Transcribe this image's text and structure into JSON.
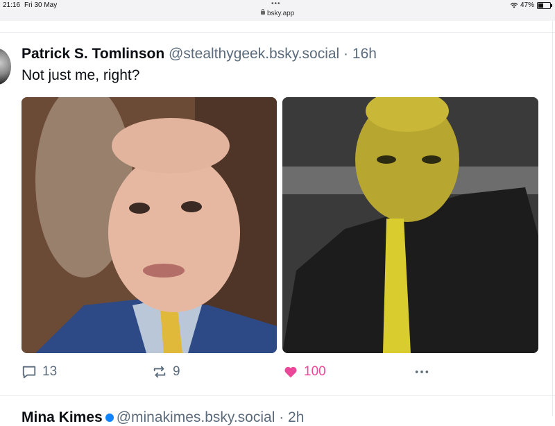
{
  "status_bar": {
    "time": "21:16",
    "date": "Fri 30 May",
    "dots": "•••",
    "url": "bsky.app",
    "battery": "47%"
  },
  "post": {
    "author_name": "Patrick S. Tomlinson",
    "author_handle": "@stealthygeek.bsky.social",
    "separator": " · ",
    "time_ago": "16h",
    "text": "Not just me, right?",
    "images": [
      {
        "icon": "photo-man-suit"
      },
      {
        "icon": "photo-creature"
      }
    ],
    "actions": {
      "reply_count": "13",
      "repost_count": "9",
      "like_count": "100"
    },
    "accent_like_color": "#ec4899"
  },
  "next_post": {
    "author_name": "Mina Kimes",
    "author_handle": "@minakimes.bsky.social",
    "separator": " · ",
    "time_ago": "2h"
  }
}
